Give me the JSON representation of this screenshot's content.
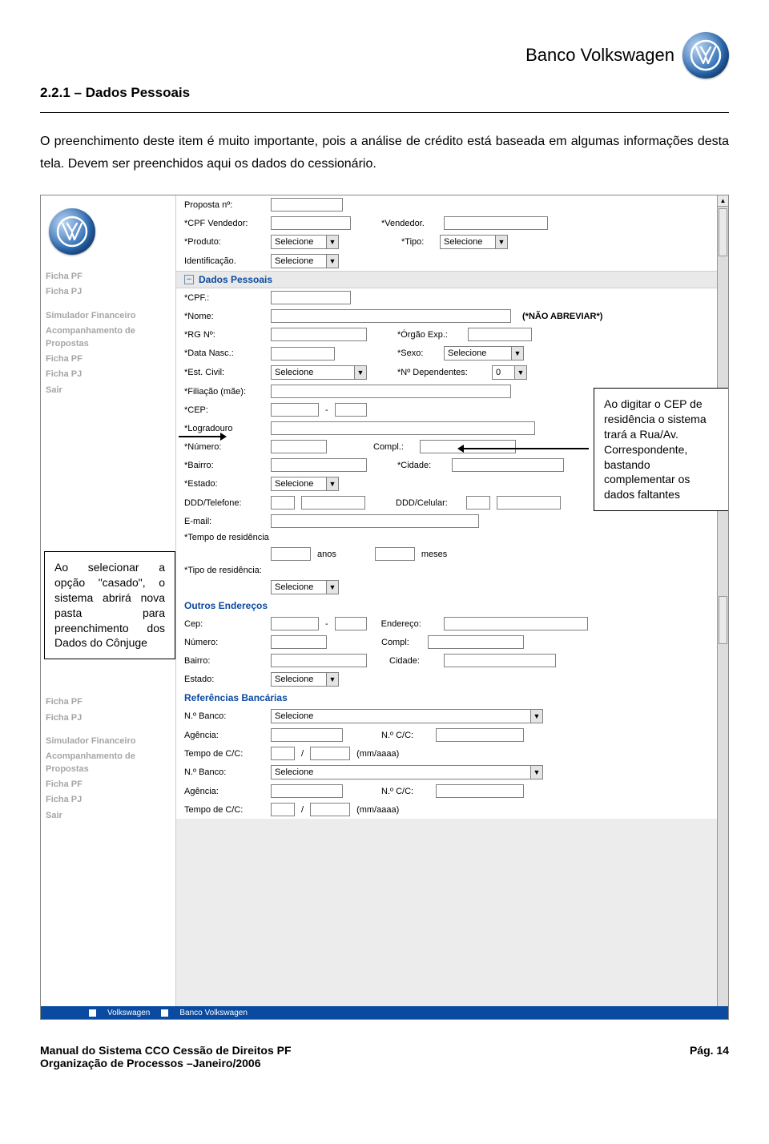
{
  "header": {
    "brand": "Banco Volkswagen"
  },
  "section": {
    "number_title": "2.2.1 – Dados Pessoais",
    "intro": "O preenchimento deste item é muito importante, pois a análise de crédito está baseada em algumas informações desta tela. Devem ser preenchidos aqui os dados do cessionário."
  },
  "callouts": {
    "left": "Ao selecionar a opção \"casado\", o sistema abrirá nova pasta para preenchimento dos Dados do Cônjuge",
    "right": "Ao digitar o CEP de residência o sistema trará a Rua/Av. Correspondente, bastando complementar os dados faltantes"
  },
  "sidebar": {
    "items1": [
      "Ficha PF",
      "Ficha PJ"
    ],
    "items2": [
      "Simulador Financeiro",
      "Acompanhamento de Propostas",
      "Ficha PF",
      "Ficha PJ",
      "Sair"
    ],
    "items3": [
      "Ficha PF",
      "Ficha PJ"
    ],
    "items4": [
      "Simulador Financeiro",
      "Acompanhamento de Propostas",
      "Ficha PF",
      "Ficha PJ",
      "Sair"
    ]
  },
  "form": {
    "proposta_lbl": "Proposta nº:",
    "cpf_vend_lbl": "*CPF Vendedor:",
    "vendedor_lbl": "*Vendedor.",
    "produto_lbl": "*Produto:",
    "tipo_lbl": "*Tipo:",
    "ident_lbl": "Identificação.",
    "selecione": "Selecione",
    "dados_pessoais": "Dados Pessoais",
    "cpf_lbl": "*CPF.:",
    "nome_lbl": "*Nome:",
    "nao_abreviar": "(*NÃO ABREVIAR*)",
    "rg_lbl": "*RG Nº:",
    "orgao_lbl": "*Órgão Exp.:",
    "data_nasc_lbl": "*Data Nasc.:",
    "sexo_lbl": "*Sexo:",
    "est_civil_lbl": "*Est. Civil:",
    "dep_lbl": "*Nº Dependentes:",
    "dep_val": "0",
    "filiacao_lbl": "*Filiação (mãe):",
    "cep_lbl": "*CEP:",
    "logradouro_lbl": "*Logradouro",
    "numero_lbl": "*Número:",
    "compl_lbl": "Compl.:",
    "bairro_lbl": "*Bairro:",
    "cidade_lbl": "*Cidade:",
    "estado_lbl": "*Estado:",
    "ddd_lbl": "DDD/Telefone:",
    "cel_lbl": "DDD/Celular:",
    "email_lbl": "E-mail:",
    "tempo_res_lbl": "*Tempo de residência",
    "anos": "anos",
    "meses": "meses",
    "tipo_res_lbl": "*Tipo de residência:",
    "outros_end": "Outros Endereços",
    "cep2_lbl": "Cep:",
    "end2_lbl": "Endereço:",
    "num2_lbl": "Número:",
    "compl2_lbl": "Compl:",
    "bairro2_lbl": "Bairro:",
    "cidade2_lbl": "Cidade:",
    "estado2_lbl": "Estado:",
    "ref_banc": "Referências Bancárias",
    "nbanco_lbl": "N.º Banco:",
    "agencia_lbl": "Agência:",
    "ncc_lbl": "N.º C/C:",
    "tempo_cc_lbl": "Tempo de C/C:",
    "slash": "/",
    "mmaaaa": "(mm/aaaa)"
  },
  "bottom": {
    "link1": "Volkswagen",
    "link2": "Banco Volkswagen"
  },
  "footer": {
    "line1": "Manual do Sistema CCO Cessão de Direitos  PF",
    "line2": "Organização de Processos –Janeiro/2006",
    "page": "Pág. 14"
  }
}
